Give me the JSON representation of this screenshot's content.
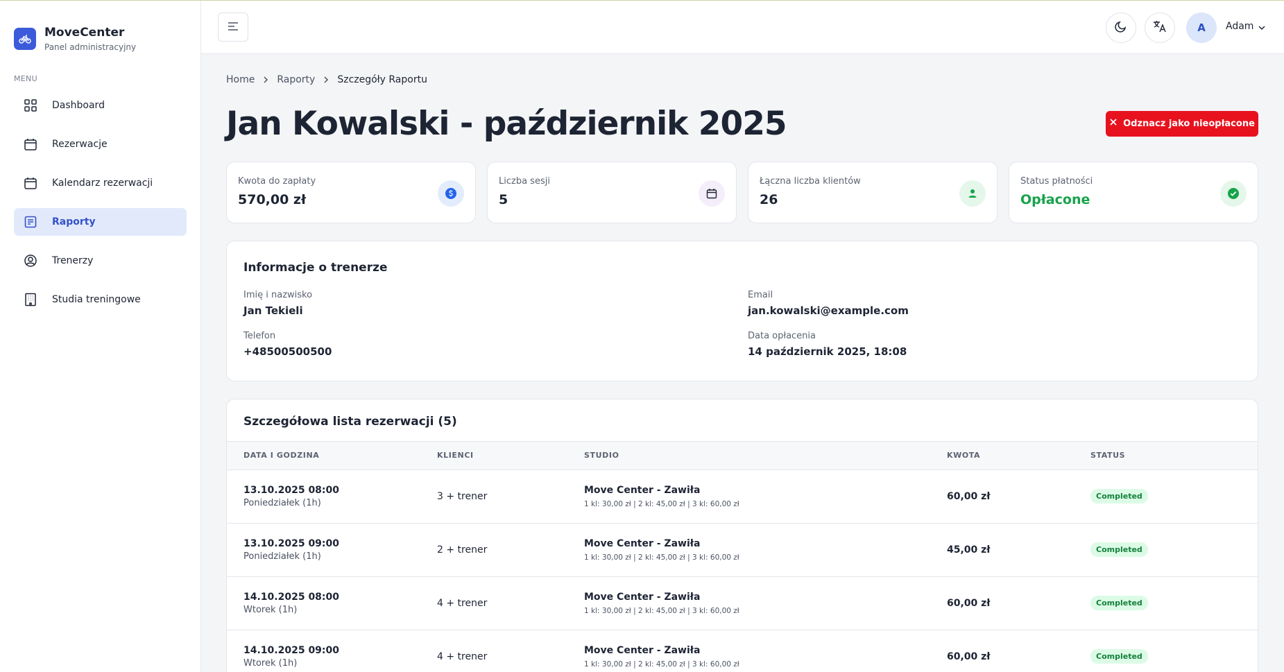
{
  "brand": {
    "title": "MoveCenter",
    "subtitle": "Panel administracyjny"
  },
  "menu_label": "MENU",
  "nav": [
    {
      "label": "Dashboard",
      "icon": "grid-icon"
    },
    {
      "label": "Rezerwacje",
      "icon": "calendar-icon"
    },
    {
      "label": "Kalendarz rezerwacji",
      "icon": "calendar-icon"
    },
    {
      "label": "Raporty",
      "icon": "report-icon",
      "active": true
    },
    {
      "label": "Trenerzy",
      "icon": "user-circle-icon"
    },
    {
      "label": "Studia treningowe",
      "icon": "building-icon"
    }
  ],
  "topbar": {
    "avatar_initial": "A",
    "username": "Adam"
  },
  "breadcrumb": [
    "Home",
    "Raporty",
    "Szczegóły Raportu"
  ],
  "page": {
    "title": "Jan Kowalski - październik 2025",
    "action_label": "Odznacz jako nieopłacone"
  },
  "stats": [
    {
      "label": "Kwota do zapłaty",
      "value": "570,00 zł",
      "icon": "dollar-icon"
    },
    {
      "label": "Liczba sesji",
      "value": "5",
      "icon": "calendar-icon"
    },
    {
      "label": "Łączna liczba klientów",
      "value": "26",
      "icon": "user-icon"
    },
    {
      "label": "Status płatności",
      "value": "Opłacone",
      "icon": "check-circle-icon"
    }
  ],
  "trainer": {
    "title": "Informacje o trenerze",
    "name_label": "Imię i nazwisko",
    "name": "Jan Tekieli",
    "email_label": "Email",
    "email": "jan.kowalski@example.com",
    "phone_label": "Telefon",
    "phone": "+48500500500",
    "paid_label": "Data opłacenia",
    "paid": "14 październik 2025, 18:08"
  },
  "reservations": {
    "title": "Szczegółowa lista rezerwacji (5)",
    "columns": [
      "DATA I GODZINA",
      "KLIENCI",
      "STUDIO",
      "KWOTA",
      "STATUS"
    ],
    "rows": [
      {
        "date": "13.10.2025 08:00",
        "day": "Poniedziałek (1h)",
        "clients": "3 + trener",
        "studio": "Move Center - Zawiła",
        "prices": "1 kl: 30,00 zł | 2 kl: 45,00 zł | 3 kl: 60,00 zł",
        "amount": "60,00 zł",
        "status": "Completed"
      },
      {
        "date": "13.10.2025 09:00",
        "day": "Poniedziałek (1h)",
        "clients": "2 + trener",
        "studio": "Move Center - Zawiła",
        "prices": "1 kl: 30,00 zł | 2 kl: 45,00 zł | 3 kl: 60,00 zł",
        "amount": "45,00 zł",
        "status": "Completed"
      },
      {
        "date": "14.10.2025 08:00",
        "day": "Wtorek (1h)",
        "clients": "4 + trener",
        "studio": "Move Center - Zawiła",
        "prices": "1 kl: 30,00 zł | 2 kl: 45,00 zł | 3 kl: 60,00 zł",
        "amount": "60,00 zł",
        "status": "Completed"
      },
      {
        "date": "14.10.2025 09:00",
        "day": "Wtorek (1h)",
        "clients": "4 + trener",
        "studio": "Move Center - Zawiła",
        "prices": "1 kl: 30,00 zł | 2 kl: 45,00 zł | 3 kl: 60,00 zł",
        "amount": "60,00 zł",
        "status": "Completed"
      }
    ]
  },
  "colors": {
    "accent": "#3b5bdb",
    "danger": "#e8121f",
    "success": "#16a34a"
  }
}
